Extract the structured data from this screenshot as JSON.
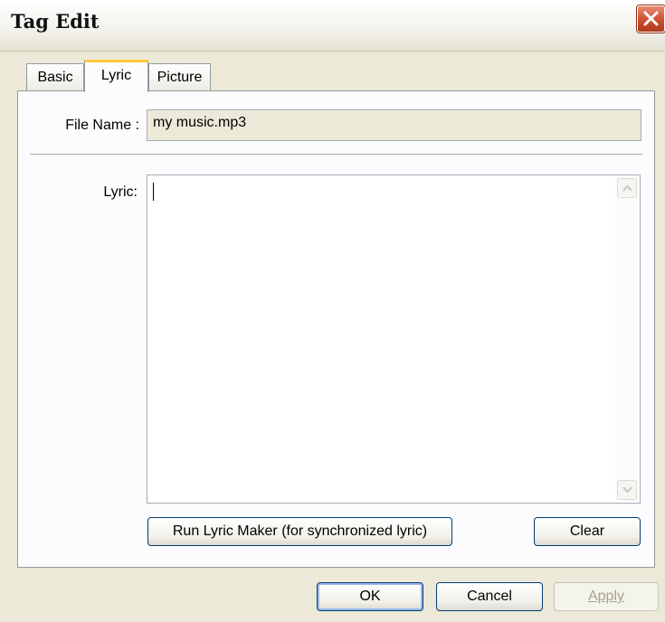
{
  "window": {
    "title": "Tag Edit"
  },
  "tabs": [
    {
      "label": "Basic"
    },
    {
      "label": "Lyric"
    },
    {
      "label": "Picture"
    }
  ],
  "file_name": {
    "label": "File Name :",
    "value": "my music.mp3"
  },
  "lyric": {
    "label": "Lyric:",
    "value": ""
  },
  "buttons": {
    "run_lyric_maker": "Run Lyric Maker (for synchronized lyric)",
    "clear": "Clear",
    "ok": "OK",
    "cancel": "Cancel",
    "apply": "Apply"
  },
  "icons": [
    "close-icon",
    "scroll-up-arrow-icon",
    "scroll-down-arrow-icon"
  ],
  "colors": {
    "dialog_bg": "#ece9d8",
    "close_red": "#c94a2c",
    "active_tab_accent": "#ffc83c"
  }
}
